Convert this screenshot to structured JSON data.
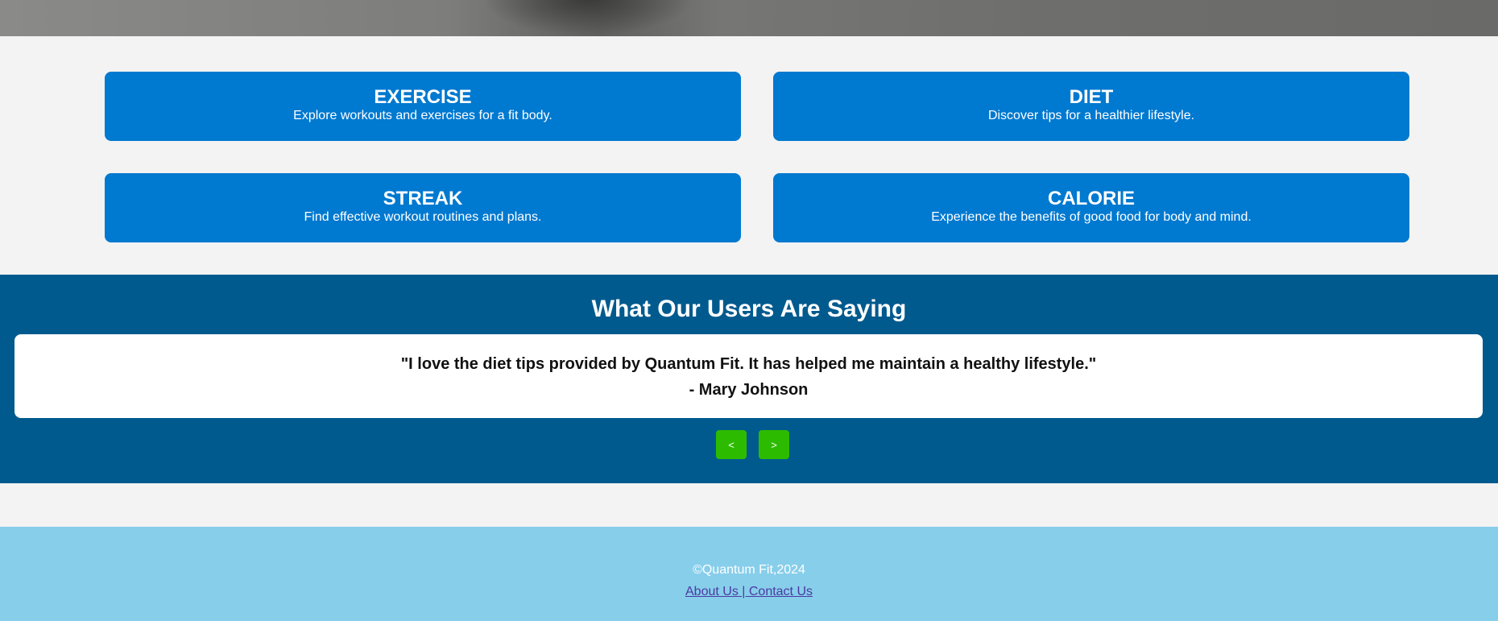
{
  "cards": [
    {
      "title": "EXERCISE",
      "description": "Explore workouts and exercises for a fit body."
    },
    {
      "title": "DIET",
      "description": "Discover tips for a healthier lifestyle."
    },
    {
      "title": "STREAK",
      "description": "Find effective workout routines and plans."
    },
    {
      "title": "CALORIE",
      "description": "Experience the benefits of good food for body and mind."
    }
  ],
  "testimonials": {
    "title": "What Our Users Are Saying",
    "quote": "\"I love the diet tips provided by Quantum Fit. It has helped me maintain a healthy lifestyle.\"",
    "author": "- Mary Johnson",
    "prev_label": "<",
    "next_label": ">"
  },
  "footer": {
    "copyright": "©Quantum Fit,2024",
    "about_label": "About Us",
    "separator": " | ",
    "contact_label": "Contact Us"
  },
  "colors": {
    "card_blue": "#0079d0",
    "testimonial_bg": "#005a8e",
    "button_green": "#2dbb00",
    "footer_bg": "#87ceeb",
    "link_color": "#4b3aa0"
  }
}
